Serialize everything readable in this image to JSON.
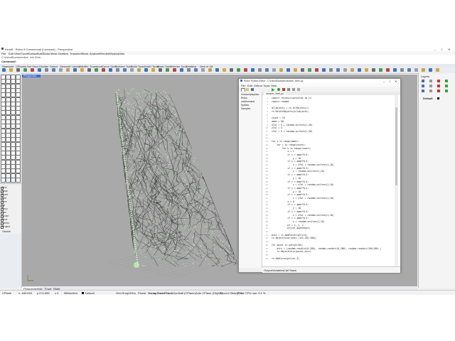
{
  "window_title": "rhino8 - Rhino 8 Commercial (Licensed) - Perspective",
  "file_path": "C:\\rhino8\\perspective_wip.3dm",
  "menu": [
    "File",
    "Edit",
    "View",
    "Curve",
    "Surface",
    "SubD",
    "Solid",
    "Mesh",
    "Drafting",
    "Transform",
    "Tools",
    "Analyze",
    "Render",
    "Window",
    "Help"
  ],
  "command_label": "Command:",
  "command_value": "",
  "toolbar_tabs": [
    "Standard",
    "CPlanes",
    "Set View",
    "Display",
    "Select",
    "Viewport Layout",
    "Visibility",
    "Transform",
    "Curve Tools",
    "Surface Tools",
    "Solid Tools",
    "SubD Tools",
    "Mesh Tools",
    "Render Tools",
    "Drafting",
    "New in V8"
  ],
  "viewport_label": "Perspective",
  "viewport_tabs": [
    "Perspective",
    "Top",
    "Front",
    "Right"
  ],
  "osnap_items": [
    "End",
    "Near",
    "Point",
    "Mid",
    "Cen",
    "Int",
    "Perp",
    "Tan",
    "Quad",
    "Knot",
    "Vertex",
    "Project",
    "Disable"
  ],
  "right_panel": {
    "title": "Layers",
    "item": "Default"
  },
  "status": {
    "cplane": "CPlane",
    "x": "x -183.543",
    "y": "y 274.556",
    "z": "z 0",
    "units": "Millimeters",
    "layer": "Default",
    "grid_snap": "Grid Snap",
    "ortho": "Ortho",
    "planar": "Planar",
    "osnap": "Osnap",
    "smarttrack": "SmartTrack",
    "gumball": "Gumball (CPlane)",
    "autocplane": "Auto CPlane (Object)",
    "record_history": "Record History",
    "filter": "Filter",
    "cpu": "CPU use: 0.1 %"
  },
  "editor": {
    "title": "Rhino Python Editor - C:\\rhino8\\scripts\\random_lines.py",
    "menu": [
      "File",
      "Edit",
      "Debug",
      "Tools",
      "Help"
    ],
    "tree": [
      "rhinoscriptsyntax",
      "Rhino",
      "scriptcontext",
      "System",
      "Samples"
    ],
    "tab": "random_lines.py",
    "bottom_tabs": [
      "Output",
      "Variables",
      "Call Stack"
    ],
    "code_lines": [
      "import rhinoscriptsyntax as rs",
      "import random",
      "",
      "allobjects = rs.AllObjects()",
      "rs.DeleteObjects(allobjects)",
      "",
      "count = 10",
      "ammt = 50",
      "xTol = 5 + random.uniform(1,20)",
      "yTol = 5",
      "zTol = 5 + random.uniform(1,20)",
      "",
      "",
      "for i in range(ammt):",
      "    for j in range(count):",
      "        for k in range(count):",
      "            x = i",
      "            if i < ammt*0.5:",
      "                y = 10",
      "            if i < ammt*0.5:",
      "                z = zTol + random.uniform(1,10)",
      "            if i < ammt*0.5:",
      "                z = random.uniform(1,10)",
      "            if i < ammt*0.5:",
      "                y = 10",
      "            if i < ammt*0.5:",
      "                z = zTol + random.uniform(1,10)",
      "            if i < ammt*0.5:",
      "                y = 10",
      "            if i < ammt*0.5:",
      "                z = zTol + random.uniform(1,10)",
      "            z = 0",
      "            if i < ammt*0.5:",
      "                y = 10",
      "            if i < ammt*0.5:",
      "                z = zTol + random.uniform(1,10)",
      "            if i < ammt*0.5:",
      "                z = random.uniform(1,10)",
      "            pt = x, y, z",
      "            ptlist.append(pt)",
      "",
      "pnts = rs.AddPoints(ptlist)",
      "rs.ObjectColor(pnts,(122,255,100))",
      "",
      "for point in pnts[0:50]:",
      "    dirv = (random.randint(0,200), random.randint(0,200), random.randint(100,200) )",
      "    rs.ObjectColor(point,dirv)",
      "",
      "rs.AddCurve(ptlist,3)"
    ]
  }
}
